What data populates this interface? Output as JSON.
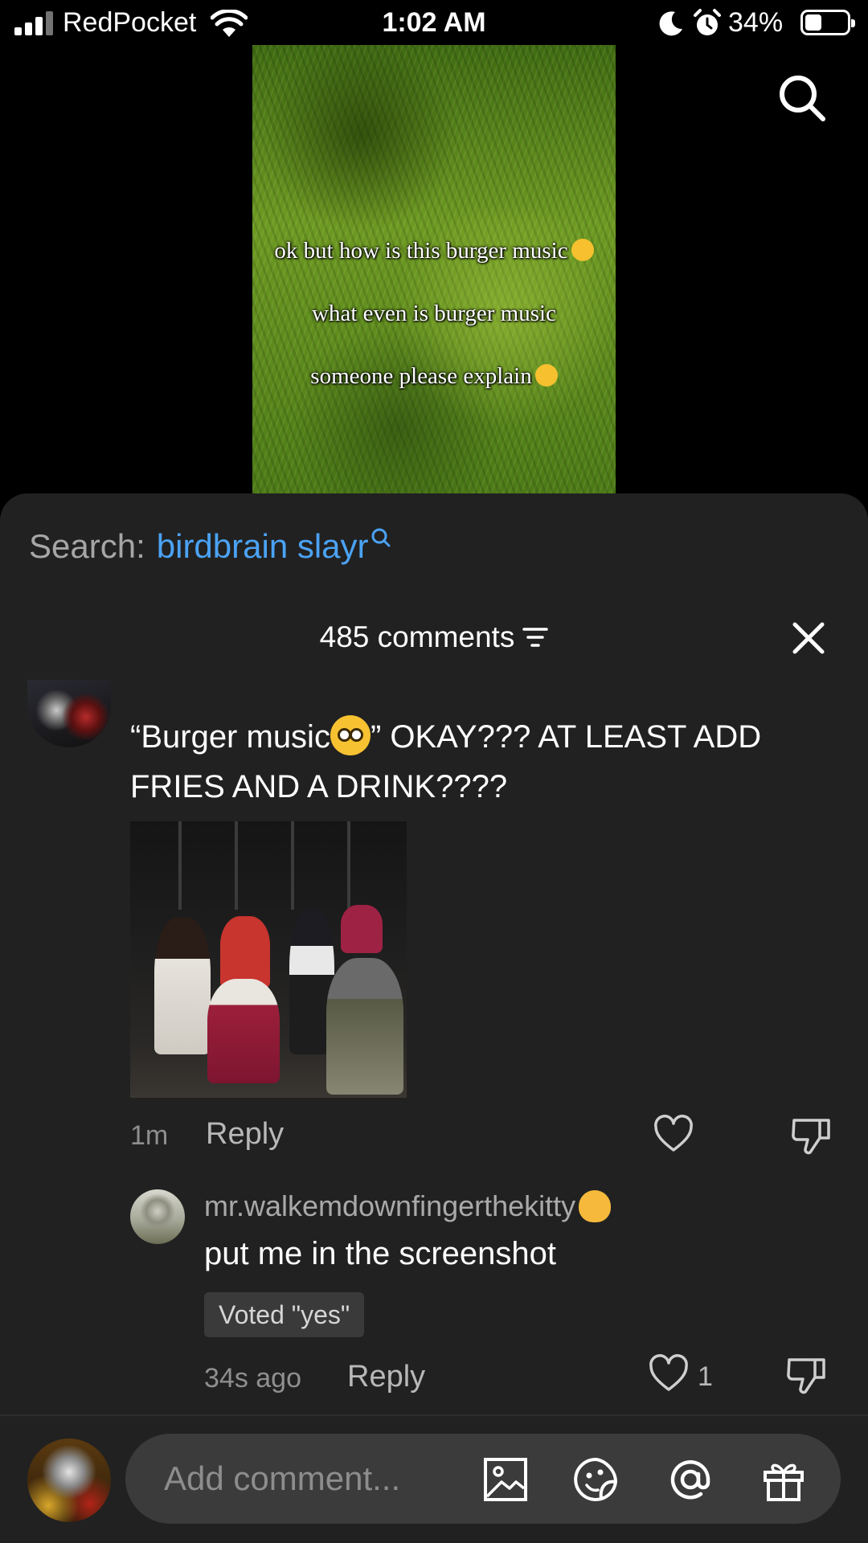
{
  "status_bar": {
    "carrier": "RedPocket",
    "time": "1:02 AM",
    "battery": "34%",
    "battery_level": 0.34
  },
  "video": {
    "captions": [
      "ok but how is this burger music",
      "what even is burger music",
      "someone please explain"
    ]
  },
  "comments_sheet": {
    "search": {
      "label": "Search:",
      "term": "birdbrain slayr"
    },
    "count": "485 comments",
    "comment": {
      "text_before": "“Burger music",
      "text_after": "” OKAY??? AT LEAST ADD FRIES AND A DRINK????",
      "time": "1m",
      "reply": "Reply"
    },
    "reply": {
      "username": "mr.walkemdownfingerthekitty",
      "text": "put me in the screenshot",
      "badge": "Voted \"yes\"",
      "time": "34s ago",
      "reply": "Reply",
      "likes": "1"
    },
    "composer": {
      "placeholder": "Add comment..."
    }
  }
}
